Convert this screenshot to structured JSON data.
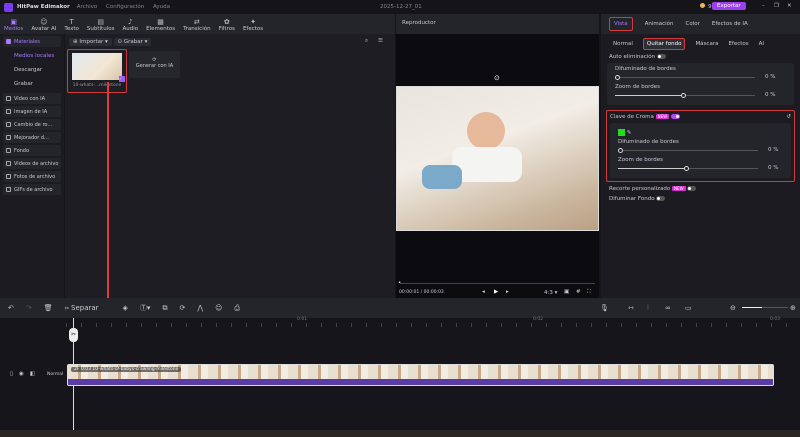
{
  "app": {
    "name": "HitPaw Edimakor",
    "menu": [
      "Archivo",
      "Configuración",
      "Ayuda"
    ],
    "project_title": "2025-12-27_01",
    "coins": "9634",
    "export_label": "Exportar"
  },
  "toolbar": [
    {
      "label": "Medios",
      "icon": "media-icon"
    },
    {
      "label": "Avatar AI",
      "icon": "avatar-icon"
    },
    {
      "label": "Texto",
      "icon": "text-icon"
    },
    {
      "label": "Subtítulos",
      "icon": "subtitles-icon"
    },
    {
      "label": "Audio",
      "icon": "audio-icon"
    },
    {
      "label": "Elementos",
      "icon": "elements-icon"
    },
    {
      "label": "Transición",
      "icon": "transition-icon"
    },
    {
      "label": "Filtros",
      "icon": "filters-icon"
    },
    {
      "label": "Efectos",
      "icon": "effects-icon"
    }
  ],
  "sidebar": {
    "header": "Materiales",
    "sub": [
      "Medios locales",
      "Descargar",
      "Grabar"
    ],
    "items": [
      "Video con IA",
      "Imagen de IA",
      "Cambio de ro...",
      "Mejorador d...",
      "Fondo",
      "Videos de archivo",
      "Fotos de archivo",
      "GIFs de archivo"
    ]
  },
  "media": {
    "import_label": "Importar",
    "record_label": "Grabar",
    "file_name": "10-whats-...milestone",
    "generate_label": "Generar con IA"
  },
  "preview": {
    "title": "Reproductor",
    "time": "00:00:01 / 00:00:03",
    "ratio": "4:3"
  },
  "right": {
    "tabs": [
      "Vista",
      "Animación",
      "Color",
      "Efectos de IA"
    ],
    "subtabs": [
      "Normal",
      "Quitar fondo",
      "Máscara",
      "Efectos",
      "AI"
    ],
    "auto_label": "Auto eliminación",
    "blur_label": "Difuminado de bordes",
    "zoom_label": "Zoom de bordes",
    "blur_value": "0",
    "zoom_value": "0",
    "unit": "%",
    "chroma_label": "Clave de Croma",
    "new_badge": "NEW",
    "chroma_color": "#22dd22",
    "chroma_blur_label": "Difuminado de bordes",
    "chroma_zoom_label": "Zoom de bordes",
    "chroma_blur_value": "0",
    "chroma_zoom_value": "0",
    "custom_label": "Recorte personalizado",
    "blur_bg_label": "Difuminar Fondo"
  },
  "timeline": {
    "split_label": "Separar",
    "ticks": [
      "0:01",
      "0:02",
      "0:03"
    ],
    "track_label": "Normal",
    "clip_label": "2F 0:03 10-whats-of-babys-crawling-milestone"
  },
  "colors": {
    "accent": "#a77cff",
    "highlight": "#d23b3b",
    "clip": "#5b3ca6"
  }
}
